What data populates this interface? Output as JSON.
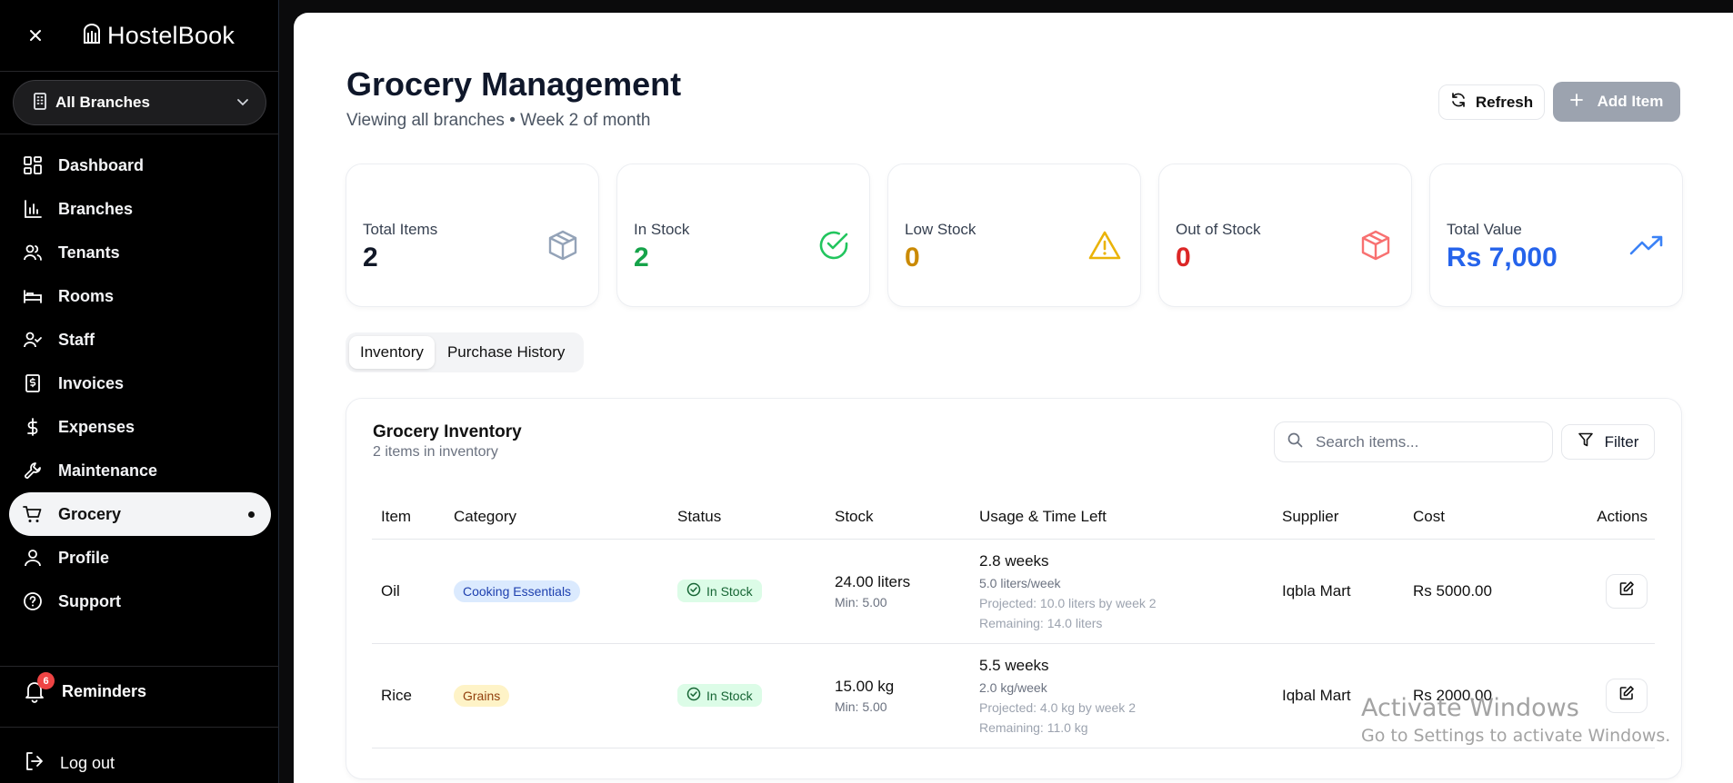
{
  "sidebar": {
    "brand": "HostelBook",
    "branch_select": "All Branches",
    "nav": [
      {
        "label": "Dashboard",
        "icon": "dashboard-icon"
      },
      {
        "label": "Branches",
        "icon": "bar-chart-icon"
      },
      {
        "label": "Tenants",
        "icon": "users-icon"
      },
      {
        "label": "Rooms",
        "icon": "bed-icon"
      },
      {
        "label": "Staff",
        "icon": "user-check-icon"
      },
      {
        "label": "Invoices",
        "icon": "invoice-icon"
      },
      {
        "label": "Expenses",
        "icon": "dollar-icon"
      },
      {
        "label": "Maintenance",
        "icon": "wrench-icon"
      },
      {
        "label": "Grocery",
        "icon": "cart-icon",
        "active": true
      },
      {
        "label": "Profile",
        "icon": "user-icon"
      },
      {
        "label": "Support",
        "icon": "help-icon"
      }
    ],
    "reminders": {
      "label": "Reminders",
      "count": "6"
    },
    "logout": "Log out"
  },
  "header": {
    "title": "Grocery Management",
    "subtitle": "Viewing all branches • Week 2 of month",
    "refresh_label": "Refresh",
    "add_label": "Add Item"
  },
  "stats": [
    {
      "label": "Total Items",
      "value": "2",
      "color": "#111827",
      "icon": "box-icon"
    },
    {
      "label": "In Stock",
      "value": "2",
      "color": "#16a34a",
      "icon": "check-circle-icon"
    },
    {
      "label": "Low Stock",
      "value": "0",
      "color": "#ca8a04",
      "icon": "warning-icon"
    },
    {
      "label": "Out of Stock",
      "value": "0",
      "color": "#dc2626",
      "icon": "box-icon"
    },
    {
      "label": "Total Value",
      "value": "Rs 7,000",
      "color": "#2563eb",
      "icon": "trending-up-icon"
    }
  ],
  "tabs": [
    "Inventory",
    "Purchase History"
  ],
  "inventory": {
    "title": "Grocery Inventory",
    "subtitle": "2 items in inventory",
    "search_placeholder": "Search items...",
    "filter_label": "Filter",
    "columns": [
      "Item",
      "Category",
      "Status",
      "Stock",
      "Usage & Time Left",
      "Supplier",
      "Cost",
      "Actions"
    ],
    "rows": [
      {
        "item": "Oil",
        "category": "Cooking Essentials",
        "status": "In Stock",
        "stock": "24.00 liters",
        "min": "Min: 5.00",
        "time_left": "2.8 weeks",
        "usage": "5.0 liters/week",
        "projected": "Projected: 10.0 liters by week 2",
        "remaining": "Remaining: 14.0 liters",
        "supplier": "Iqbla Mart",
        "cost": "Rs 5000.00"
      },
      {
        "item": "Rice",
        "category": "Grains",
        "status": "In Stock",
        "stock": "15.00 kg",
        "min": "Min: 5.00",
        "time_left": "5.5 weeks",
        "usage": "2.0 kg/week",
        "projected": "Projected: 4.0 kg by week 2",
        "remaining": "Remaining: 11.0 kg",
        "supplier": "Iqbal Mart",
        "cost": "Rs 2000.00"
      }
    ]
  },
  "watermark": {
    "line1": "Activate Windows",
    "line2": "Go to Settings to activate Windows."
  }
}
